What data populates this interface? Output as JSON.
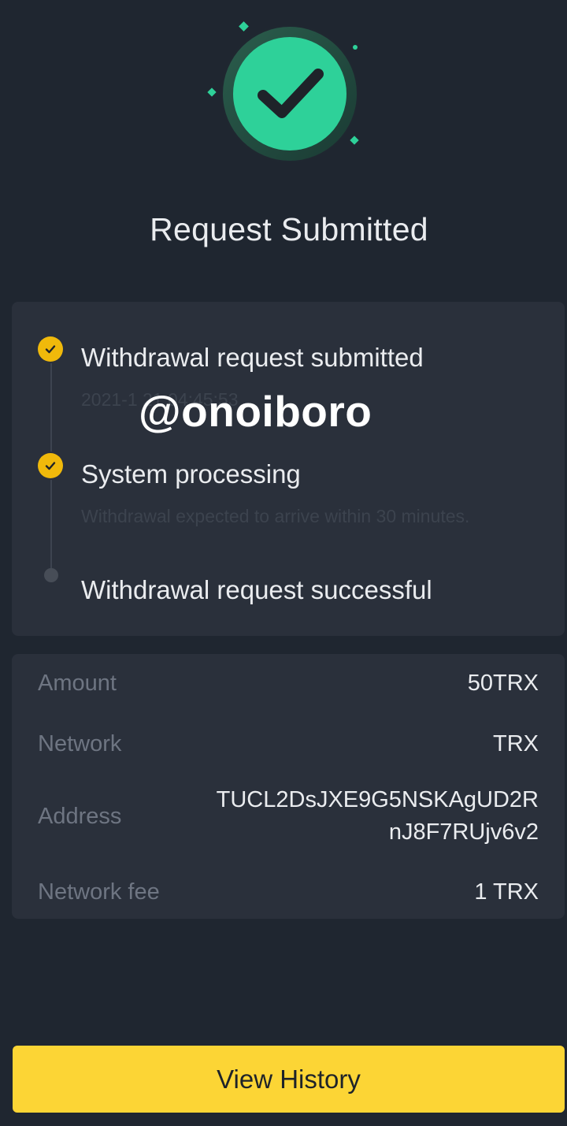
{
  "header": {
    "title": "Request Submitted"
  },
  "timeline": {
    "steps": [
      {
        "title": "Withdrawal request submitted",
        "subtitle": "2021-1 21 04:45:53",
        "status": "done"
      },
      {
        "title": "System processing",
        "subtitle": "Withdrawal expected to arrive within 30 minutes.",
        "status": "done"
      },
      {
        "title": "Withdrawal request successful",
        "status": "pending"
      }
    ]
  },
  "watermark": "@onoiboro",
  "details": {
    "amount": {
      "label": "Amount",
      "value": "50TRX"
    },
    "network": {
      "label": "Network",
      "value": "TRX"
    },
    "address": {
      "label": "Address",
      "value_line1": "TUCL2DsJXE9G5NSKAgUD2R",
      "value_line2": "nJ8F7RUjv6v2"
    },
    "fee": {
      "label": "Network fee",
      "value": "1 TRX"
    }
  },
  "actions": {
    "view_history_label": "View History"
  },
  "colors": {
    "background": "#1f2630",
    "card": "#2a303b",
    "success_green": "#2ed199",
    "step_yellow": "#f0b90b",
    "button_yellow": "#fcd535"
  },
  "icons": {
    "hero": "success-check-icon",
    "step_done": "check-icon"
  }
}
